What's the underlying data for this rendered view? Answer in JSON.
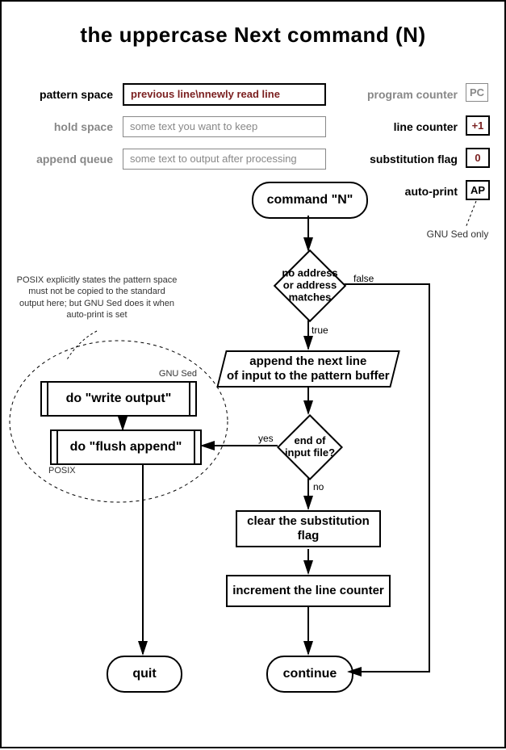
{
  "title": "the uppercase Next command (N)",
  "left_labels": {
    "pattern_space": "pattern space",
    "hold_space": "hold space",
    "append_queue": "append queue"
  },
  "fields": {
    "pattern_space": "previous line\\nnewly read line",
    "hold_space": "some text you want to keep",
    "append_queue": "some text to output after processing"
  },
  "right_labels": {
    "program_counter": "program counter",
    "line_counter": "line counter",
    "substitution_flag": "substitution flag",
    "auto_print": "auto-print"
  },
  "right_values": {
    "program_counter": "PC",
    "line_counter": "+1",
    "substitution_flag": "0",
    "auto_print": "AP"
  },
  "gnu_note": "GNU Sed only",
  "posix_note": "POSIX explicitly states the pattern space must not be copied to the standard output here; but GNU Sed does it when auto-print is set",
  "nodes": {
    "command": "command \"N\"",
    "addr": "no address\nor address\nmatches",
    "append": "append the next line\nof input to the pattern buffer",
    "eof": "end of\ninput file?",
    "clear": "clear the substitution\nflag",
    "incr": "increment the line counter",
    "continue": "continue",
    "quit": "quit",
    "write": "do \"write output\"",
    "flush": "do \"flush append\""
  },
  "sub_labels": {
    "gnu": "GNU Sed",
    "posix": "POSIX"
  },
  "edges": {
    "true": "true",
    "false": "false",
    "yes": "yes",
    "no": "no"
  }
}
